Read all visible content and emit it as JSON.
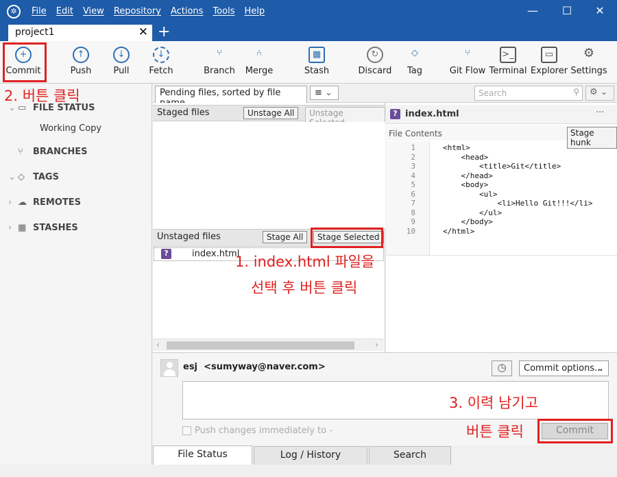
{
  "titlebar": {
    "menu": [
      "File",
      "Edit",
      "View",
      "Repository",
      "Actions",
      "Tools",
      "Help"
    ],
    "minimize": "—",
    "maximize": "☐",
    "close": "✕"
  },
  "tab": {
    "label": "project1",
    "close": "✕",
    "add": "+"
  },
  "toolbar": {
    "commit": "Commit",
    "push": "Push",
    "pull": "Pull",
    "fetch": "Fetch",
    "branch": "Branch",
    "merge": "Merge",
    "stash": "Stash",
    "discard": "Discard",
    "tag": "Tag",
    "gitflow": "Git Flow",
    "terminal": "Terminal",
    "explorer": "Explorer",
    "settings": "Settings"
  },
  "sidebar": {
    "file_status": "FILE STATUS",
    "working_copy": "Working Copy",
    "branches": "BRANCHES",
    "tags": "TAGS",
    "remotes": "REMOTES",
    "stashes": "STASHES"
  },
  "filter": {
    "sort_label": "Pending files, sorted by file name",
    "list_icon": "≡",
    "search_placeholder": "Search"
  },
  "staged": {
    "header": "Staged files",
    "unstage_all": "Unstage All",
    "unstage_selected": "Unstage Selected"
  },
  "unstaged": {
    "header": "Unstaged files",
    "stage_all": "Stage All",
    "stage_selected": "Stage Selected",
    "files": [
      {
        "badge": "?",
        "name": "index.html"
      }
    ]
  },
  "diff": {
    "file_badge": "?",
    "file_name": "index.html",
    "more": "···",
    "contents_label": "File Contents",
    "stage_hunk": "Stage hunk",
    "line_numbers": [
      "1",
      "2",
      "3",
      "4",
      "5",
      "6",
      "7",
      "8",
      "9",
      "10"
    ],
    "lines": [
      "<html>",
      "    <head>",
      "        <title>Git</title>",
      "    </head>",
      "    <body>",
      "        <ul>",
      "            <li>Hello Git!!!</li>",
      "        </ul>",
      "    </body>",
      "</html>"
    ]
  },
  "commit": {
    "author": "esj  <sumyway@naver.com>",
    "options": "Commit options...",
    "push_immediately": "Push changes immediately to -",
    "button": "Commit"
  },
  "bottom_tabs": [
    "File Status",
    "Log / History",
    "Search"
  ],
  "annotations": {
    "step1_line1": "1. index.html 파일을",
    "step1_line2": "선택 후 버튼 클릭",
    "step2": "2. 버튼 클릭",
    "step3_line1": "3. 이력 남기고",
    "step3_line2": "버튼 클릭"
  },
  "colors": {
    "accent": "#1e5ba8",
    "annotation": "#e02020"
  }
}
